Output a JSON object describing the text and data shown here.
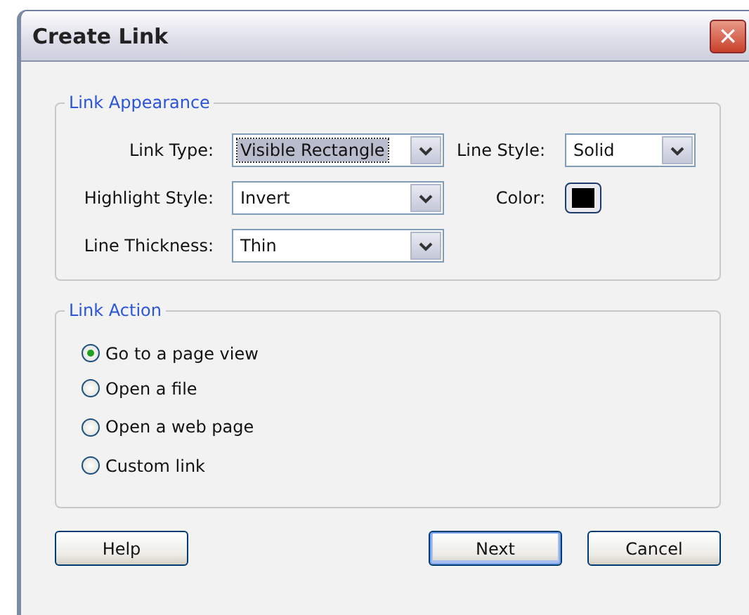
{
  "window": {
    "title": "Create Link",
    "close_icon": "×"
  },
  "link_appearance": {
    "title": "Link Appearance",
    "fields": [
      {
        "kind": "select",
        "label": "Link Type:",
        "value": "Visible Rectangle",
        "focused": true
      },
      {
        "kind": "select",
        "label": "Line Style:",
        "value": "Solid",
        "focused": false
      },
      {
        "kind": "select",
        "label": "Highlight Style:",
        "value": "Invert",
        "focused": false
      },
      {
        "kind": "color",
        "label": "Color:",
        "color": "#000000"
      },
      {
        "kind": "select",
        "label": "Line Thickness:",
        "value": "Thin",
        "focused": false
      }
    ]
  },
  "link_action": {
    "title": "Link Action",
    "options": [
      {
        "label": "Go to a page view",
        "selected": true
      },
      {
        "label": "Open a file",
        "selected": false
      },
      {
        "label": "Open a web page",
        "selected": false
      },
      {
        "label": "Custom link",
        "selected": false
      }
    ]
  },
  "buttons": [
    {
      "label": "Help",
      "default": false
    },
    {
      "label": "Next",
      "default": true
    },
    {
      "label": "Cancel",
      "default": false
    }
  ]
}
